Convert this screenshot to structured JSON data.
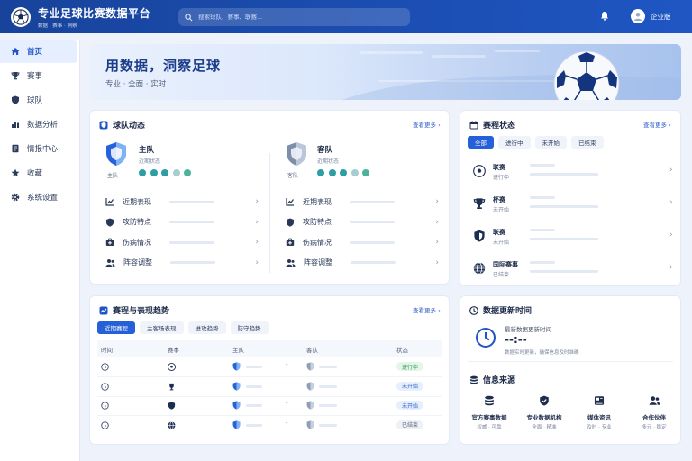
{
  "app": {
    "title": "专业足球比赛数据平台",
    "subtitle": "数据 · 赛事 · 洞察"
  },
  "search": {
    "placeholder": "搜索球队、赛事、联赛..."
  },
  "user": {
    "name": "企业版"
  },
  "sidebar": {
    "items": [
      {
        "label": "首页",
        "icon": "home-icon",
        "active": true
      },
      {
        "label": "赛事",
        "icon": "trophy-icon"
      },
      {
        "label": "球队",
        "icon": "shield-icon"
      },
      {
        "label": "数据分析",
        "icon": "bar-chart-icon"
      },
      {
        "label": "情报中心",
        "icon": "document-icon"
      },
      {
        "label": "收藏",
        "icon": "star-icon"
      },
      {
        "label": "系统设置",
        "icon": "gear-icon"
      }
    ]
  },
  "hero": {
    "title": "用数据，洞察足球",
    "tagline": "专业 · 全面 · 实时"
  },
  "team_dynamics": {
    "title": "球队动态",
    "more": "查看更多",
    "home": {
      "name": "主队",
      "status": "近期状态",
      "label": "主队",
      "form_colors": [
        "#2e9ea5",
        "#2e9ea5",
        "#2e9ea5",
        "#a6cdd0",
        "#4cb39a"
      ]
    },
    "away": {
      "name": "客队",
      "status": "近期状态",
      "label": "客队",
      "form_colors": [
        "#2e9ea5",
        "#2e9ea5",
        "#2e9ea5",
        "#a6cdd0",
        "#4cb39a"
      ]
    },
    "rows": [
      {
        "label": "近期表现",
        "icon": "chart-icon"
      },
      {
        "label": "攻防特点",
        "icon": "shield-icon"
      },
      {
        "label": "伤病情况",
        "icon": "medical-kit-icon"
      },
      {
        "label": "阵容调整",
        "icon": "users-icon"
      }
    ]
  },
  "match_status": {
    "title": "赛程状态",
    "more": "查看更多",
    "tabs": [
      "全部",
      "进行中",
      "未开始",
      "已结束"
    ],
    "items": [
      {
        "title": "联赛",
        "status": "进行中",
        "icon": "soccer-ball-icon"
      },
      {
        "title": "杯赛",
        "status": "未开始",
        "icon": "trophy-icon"
      },
      {
        "title": "联赛",
        "status": "未开始",
        "icon": "shield-icon"
      },
      {
        "title": "国际赛事",
        "status": "已结束",
        "icon": "globe-icon"
      }
    ]
  },
  "trends": {
    "title": "赛程与表现趋势",
    "more": "查看更多",
    "tabs": [
      "近期赛程",
      "主客场表现",
      "进攻趋势",
      "防守趋势"
    ],
    "columns": [
      "时间",
      "赛事",
      "主队",
      "客队",
      "状态"
    ],
    "rows": [
      {
        "event_icon": "soccer-ball-icon",
        "sep": "-",
        "status": "进行中"
      },
      {
        "event_icon": "trophy-icon",
        "sep": "-",
        "status": "未开始"
      },
      {
        "event_icon": "shield-icon",
        "sep": "-",
        "status": "未开始"
      },
      {
        "event_icon": "globe-icon",
        "sep": "-",
        "status": "已结束"
      }
    ],
    "status_colors": {
      "进行中": "#2f9d57",
      "未开始": "#2d63cf",
      "已结束": "#5c6780"
    }
  },
  "update": {
    "title": "数据更新时间",
    "label": "最新数据更新时间",
    "time": "--:--",
    "note": "数据实时更新，确保信息及时准确"
  },
  "sources": {
    "title": "信息来源",
    "items": [
      {
        "name": "官方赛事数据",
        "desc": "权威 · 可靠",
        "icon": "database-icon"
      },
      {
        "name": "专业数据机构",
        "desc": "全面 · 精准",
        "icon": "shield-check-icon"
      },
      {
        "name": "媒体资讯",
        "desc": "及时 · 专业",
        "icon": "newspaper-icon"
      },
      {
        "name": "合作伙伴",
        "desc": "多元 · 稳定",
        "icon": "users-icon"
      }
    ]
  },
  "colors": {
    "primary": "#1f56c3",
    "accent": "#2560d8",
    "background": "#eef3fb"
  }
}
